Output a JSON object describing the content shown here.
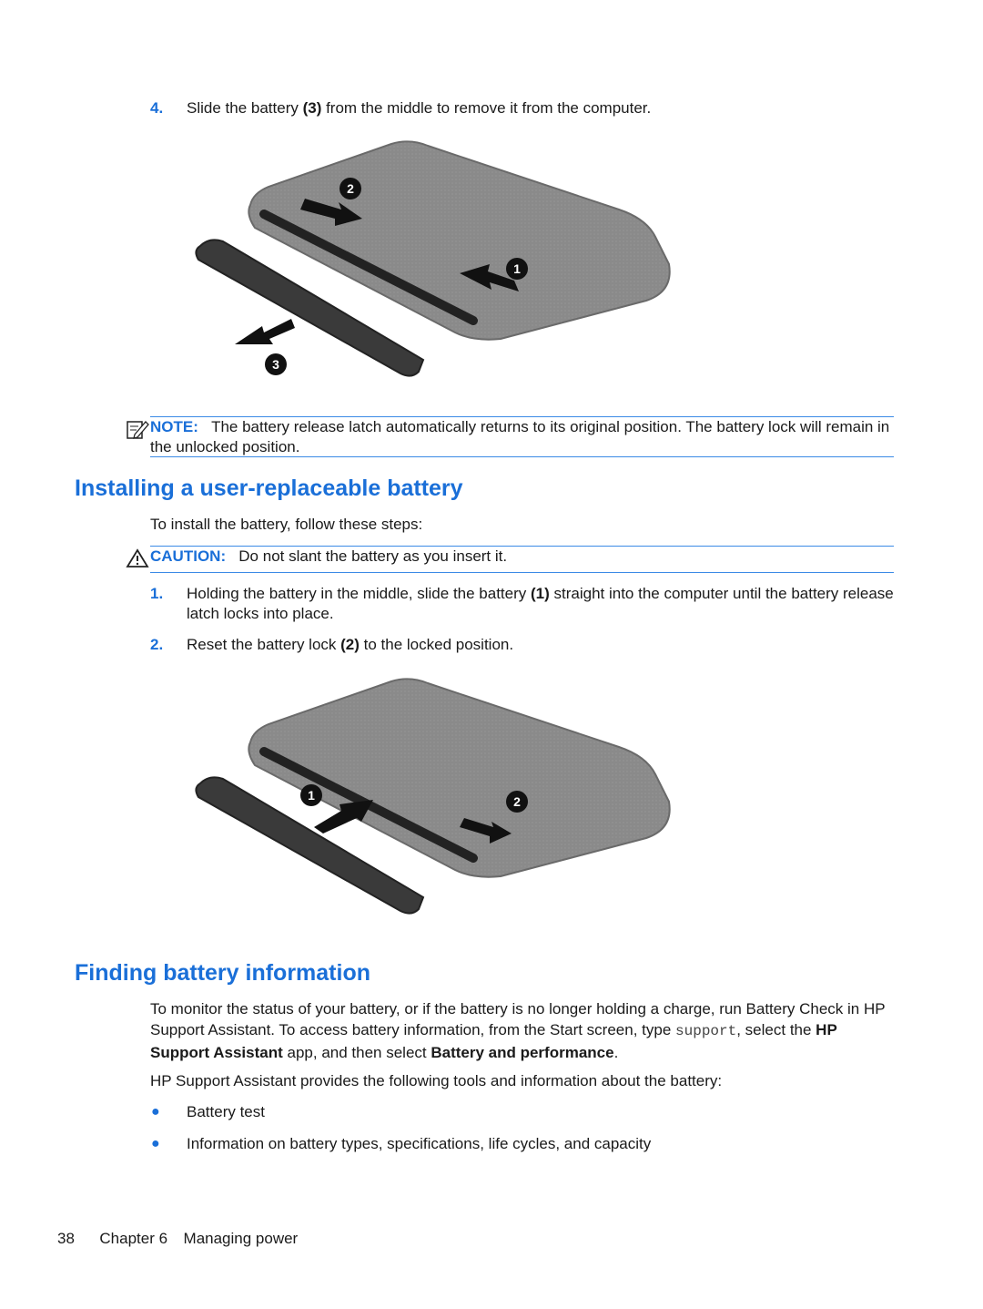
{
  "removal": {
    "step4": {
      "number": "4.",
      "text_before": "Slide the battery ",
      "bold": "(3)",
      "text_after": " from the middle to remove it from the computer."
    },
    "illustration": {
      "callouts": [
        "2",
        "1",
        "3"
      ],
      "description": "Laptop underside with battery being removed"
    },
    "note": {
      "icon": "note-pencil-icon",
      "label": "NOTE:",
      "text": "The battery release latch automatically returns to its original position. The battery lock will remain in the unlocked position."
    }
  },
  "installing": {
    "heading": "Installing a user-replaceable battery",
    "intro": "To install the battery, follow these steps:",
    "caution": {
      "icon": "warning-triangle-icon",
      "label": "CAUTION:",
      "text": "Do not slant the battery as you insert it."
    },
    "steps": [
      {
        "number": "1.",
        "text_before": "Holding the battery in the middle, slide the battery ",
        "bold": "(1)",
        "text_after": " straight into the computer until the battery release latch locks into place."
      },
      {
        "number": "2.",
        "text_before": "Reset the battery lock ",
        "bold": "(2)",
        "text_after": " to the locked position."
      }
    ],
    "illustration": {
      "callouts": [
        "1",
        "2"
      ],
      "description": "Laptop underside with battery being inserted"
    }
  },
  "finding": {
    "heading": "Finding battery information",
    "para1": {
      "t1": "To monitor the status of your battery, or if the battery is no longer holding a charge, run Battery Check in HP Support Assistant. To access battery information, from the Start screen, type ",
      "code": "support",
      "t2": ", select the ",
      "bold1": "HP Support Assistant",
      "t3": " app, and then select ",
      "bold2": "Battery and performance",
      "t4": "."
    },
    "para2": "HP Support Assistant provides the following tools and information about the battery:",
    "bullets": [
      "Battery test",
      "Information on battery types, specifications, life cycles, and capacity"
    ]
  },
  "footer": {
    "page_number": "38",
    "chapter": "Chapter 6",
    "chapter_title": "Managing power"
  },
  "colors": {
    "accent": "#1a6fd8",
    "rule": "#3b8ae6"
  }
}
